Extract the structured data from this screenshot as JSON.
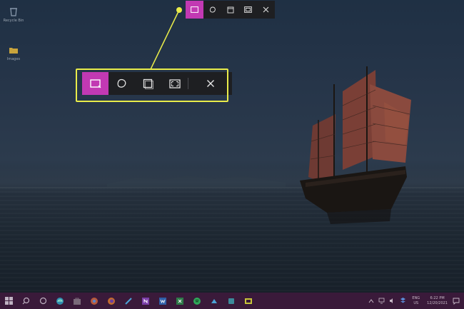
{
  "desktop": {
    "icons": [
      {
        "label": "Recycle Bin",
        "icon": "recycle-bin-icon"
      },
      {
        "label": "Images",
        "icon": "folder-icon"
      }
    ],
    "wallpaper": "junk-boat-at-dusk"
  },
  "snipping_toolbar": {
    "buttons": [
      {
        "name": "rectangular-snip",
        "icon": "rectangular-snip-icon",
        "active": true
      },
      {
        "name": "freeform-snip",
        "icon": "freeform-snip-icon",
        "active": false
      },
      {
        "name": "window-snip",
        "icon": "window-snip-icon",
        "active": false
      },
      {
        "name": "fullscreen-snip",
        "icon": "fullscreen-snip-icon",
        "active": false
      },
      {
        "name": "close",
        "icon": "close-icon",
        "active": false
      }
    ],
    "colors": {
      "active": "#c239b3",
      "toolbar_bg": "#1e1f22",
      "callout": "#e9ec4a"
    }
  },
  "taskbar": {
    "apps": [
      "windows-logo-icon",
      "search-icon",
      "task-view-icon",
      "edge-icon",
      "store-icon",
      "chrome-icon",
      "firefox-icon",
      "app-icon",
      "onenote-icon",
      "word-icon",
      "excel-icon",
      "spotify-icon",
      "app-icon",
      "app-icon",
      "snip-sketch-icon"
    ],
    "tray": {
      "language": "ENG",
      "region": "US",
      "time": "6:22 PM",
      "date": "12/20/2021"
    },
    "accent": "#3a1a3a"
  }
}
